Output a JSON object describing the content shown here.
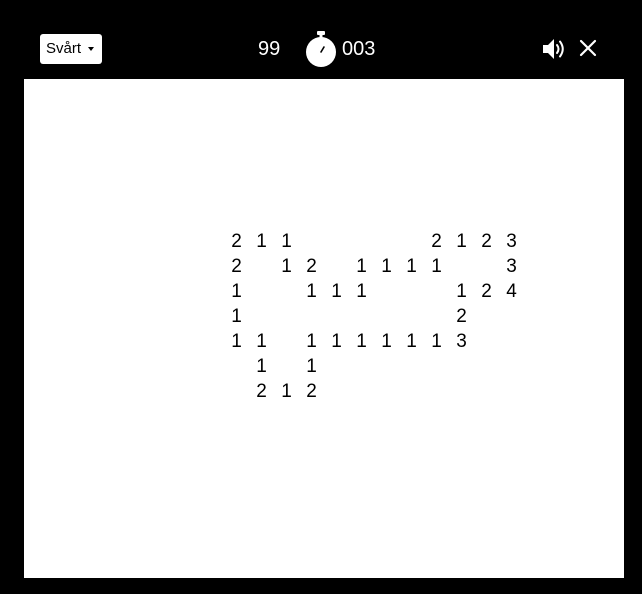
{
  "header": {
    "difficulty_label": "Svårt",
    "mine_count": "99",
    "timer": "003",
    "icons": {
      "difficulty_caret": "caret-down-icon",
      "timer": "stopwatch-icon",
      "sound": "speaker-icon",
      "close": "close-icon"
    }
  },
  "board": {
    "revealed_numbers": [
      {
        "row": 0,
        "col": 0,
        "value": "2"
      },
      {
        "row": 0,
        "col": 1,
        "value": "1"
      },
      {
        "row": 0,
        "col": 2,
        "value": "1"
      },
      {
        "row": 0,
        "col": 8,
        "value": "2"
      },
      {
        "row": 0,
        "col": 9,
        "value": "1"
      },
      {
        "row": 0,
        "col": 10,
        "value": "2"
      },
      {
        "row": 0,
        "col": 11,
        "value": "3"
      },
      {
        "row": 1,
        "col": 0,
        "value": "2"
      },
      {
        "row": 1,
        "col": 2,
        "value": "1"
      },
      {
        "row": 1,
        "col": 3,
        "value": "2"
      },
      {
        "row": 1,
        "col": 5,
        "value": "1"
      },
      {
        "row": 1,
        "col": 6,
        "value": "1"
      },
      {
        "row": 1,
        "col": 7,
        "value": "1"
      },
      {
        "row": 1,
        "col": 8,
        "value": "1"
      },
      {
        "row": 1,
        "col": 11,
        "value": "3"
      },
      {
        "row": 2,
        "col": 0,
        "value": "1"
      },
      {
        "row": 2,
        "col": 3,
        "value": "1"
      },
      {
        "row": 2,
        "col": 4,
        "value": "1"
      },
      {
        "row": 2,
        "col": 5,
        "value": "1"
      },
      {
        "row": 2,
        "col": 9,
        "value": "1"
      },
      {
        "row": 2,
        "col": 10,
        "value": "2"
      },
      {
        "row": 2,
        "col": 11,
        "value": "4"
      },
      {
        "row": 3,
        "col": 0,
        "value": "1"
      },
      {
        "row": 3,
        "col": 9,
        "value": "2"
      },
      {
        "row": 4,
        "col": 0,
        "value": "1"
      },
      {
        "row": 4,
        "col": 1,
        "value": "1"
      },
      {
        "row": 4,
        "col": 3,
        "value": "1"
      },
      {
        "row": 4,
        "col": 4,
        "value": "1"
      },
      {
        "row": 4,
        "col": 5,
        "value": "1"
      },
      {
        "row": 4,
        "col": 6,
        "value": "1"
      },
      {
        "row": 4,
        "col": 7,
        "value": "1"
      },
      {
        "row": 4,
        "col": 8,
        "value": "1"
      },
      {
        "row": 4,
        "col": 9,
        "value": "3"
      },
      {
        "row": 5,
        "col": 1,
        "value": "1"
      },
      {
        "row": 5,
        "col": 3,
        "value": "1"
      },
      {
        "row": 6,
        "col": 1,
        "value": "2"
      },
      {
        "row": 6,
        "col": 2,
        "value": "1"
      },
      {
        "row": 6,
        "col": 3,
        "value": "2"
      }
    ]
  }
}
